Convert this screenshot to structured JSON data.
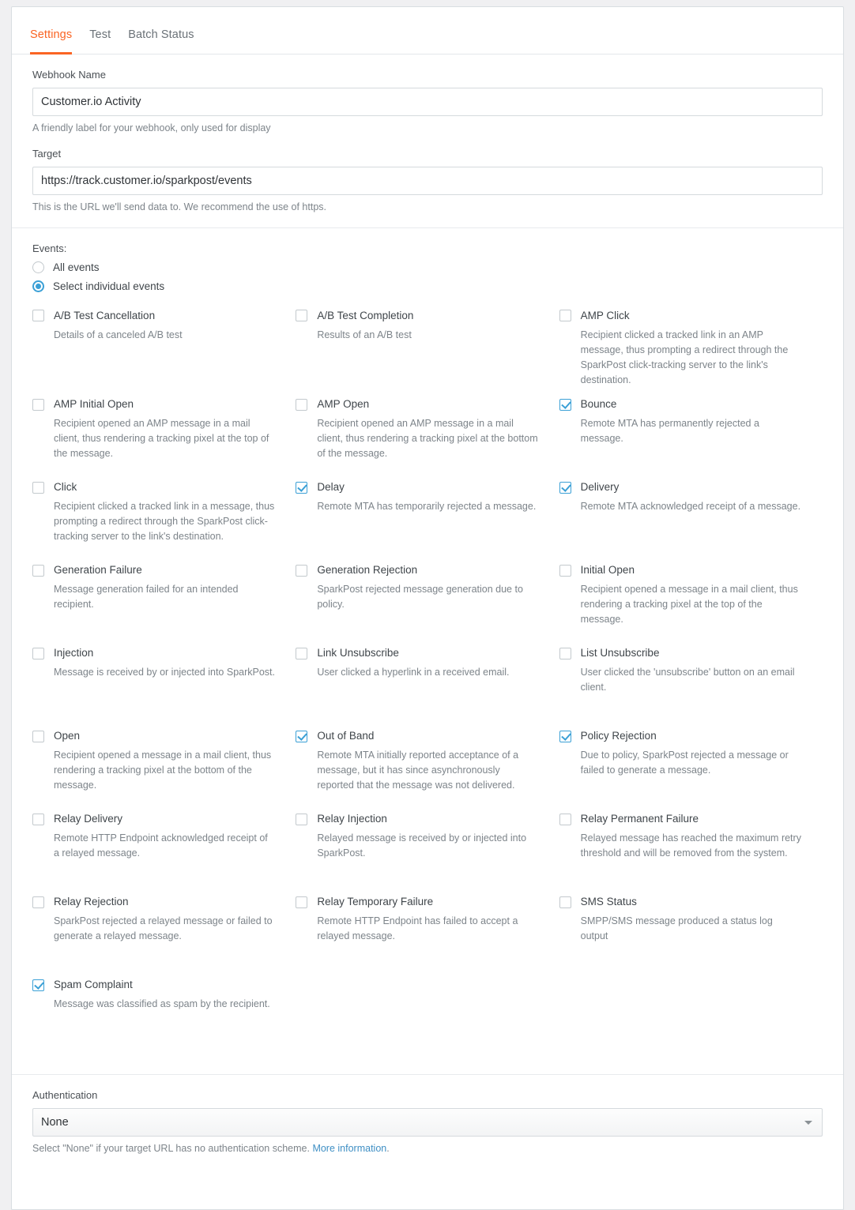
{
  "tabs": [
    {
      "label": "Settings",
      "active": true
    },
    {
      "label": "Test",
      "active": false
    },
    {
      "label": "Batch Status",
      "active": false
    }
  ],
  "colors": {
    "accent": "#fa6423",
    "checkbox_checked": "#3ba0d6",
    "link": "#3f8fc4"
  },
  "webhook_name": {
    "label": "Webhook Name",
    "value": "Customer.io Activity",
    "placeholder": "Webhook Name",
    "help": "A friendly label for your webhook, only used for display"
  },
  "target": {
    "label": "Target",
    "value": "https://track.customer.io/sparkpost/events",
    "placeholder": "https://",
    "help": "This is the URL we'll send data to. We recommend the use of https."
  },
  "events": {
    "label": "Events:",
    "radios": [
      {
        "label": "All events",
        "checked": false
      },
      {
        "label": "Select individual events",
        "checked": true
      }
    ],
    "items": [
      {
        "name": "A/B Test Cancellation",
        "desc": "Details of a canceled A/B test",
        "checked": false
      },
      {
        "name": "A/B Test Completion",
        "desc": "Results of an A/B test",
        "checked": false
      },
      {
        "name": "AMP Click",
        "desc": "Recipient clicked a tracked link in an AMP message, thus prompting a redirect through the SparkPost click-tracking server to the link's destination.",
        "checked": false
      },
      {
        "name": "AMP Initial Open",
        "desc": "Recipient opened an AMP message in a mail client, thus rendering a tracking pixel at the top of the message.",
        "checked": false
      },
      {
        "name": "AMP Open",
        "desc": "Recipient opened an AMP message in a mail client, thus rendering a tracking pixel at the bottom of the message.",
        "checked": false
      },
      {
        "name": "Bounce",
        "desc": "Remote MTA has permanently rejected a message.",
        "checked": true
      },
      {
        "name": "Click",
        "desc": "Recipient clicked a tracked link in a message, thus prompting a redirect through the SparkPost click-tracking server to the link's destination.",
        "checked": false
      },
      {
        "name": "Delay",
        "desc": "Remote MTA has temporarily rejected a message.",
        "checked": true
      },
      {
        "name": "Delivery",
        "desc": "Remote MTA acknowledged receipt of a message.",
        "checked": true
      },
      {
        "name": "Generation Failure",
        "desc": "Message generation failed for an intended recipient.",
        "checked": false
      },
      {
        "name": "Generation Rejection",
        "desc": "SparkPost rejected message generation due to policy.",
        "checked": false
      },
      {
        "name": "Initial Open",
        "desc": "Recipient opened a message in a mail client, thus rendering a tracking pixel at the top of the message.",
        "checked": false
      },
      {
        "name": "Injection",
        "desc": "Message is received by or injected into SparkPost.",
        "checked": false
      },
      {
        "name": "Link Unsubscribe",
        "desc": "User clicked a hyperlink in a received email.",
        "checked": false
      },
      {
        "name": "List Unsubscribe",
        "desc": "User clicked the 'unsubscribe' button on an email client.",
        "checked": false
      },
      {
        "name": "Open",
        "desc": "Recipient opened a message in a mail client, thus rendering a tracking pixel at the bottom of the message.",
        "checked": false
      },
      {
        "name": "Out of Band",
        "desc": "Remote MTA initially reported acceptance of a message, but it has since asynchronously reported that the message was not delivered.",
        "checked": true
      },
      {
        "name": "Policy Rejection",
        "desc": "Due to policy, SparkPost rejected a message or failed to generate a message.",
        "checked": true
      },
      {
        "name": "Relay Delivery",
        "desc": "Remote HTTP Endpoint acknowledged receipt of a relayed message.",
        "checked": false
      },
      {
        "name": "Relay Injection",
        "desc": "Relayed message is received by or injected into SparkPost.",
        "checked": false
      },
      {
        "name": "Relay Permanent Failure",
        "desc": "Relayed message has reached the maximum retry threshold and will be removed from the system.",
        "checked": false
      },
      {
        "name": "Relay Rejection",
        "desc": "SparkPost rejected a relayed message or failed to generate a relayed message.",
        "checked": false
      },
      {
        "name": "Relay Temporary Failure",
        "desc": "Remote HTTP Endpoint has failed to accept a relayed message.",
        "checked": false
      },
      {
        "name": "SMS Status",
        "desc": "SMPP/SMS message produced a status log output",
        "checked": false
      },
      {
        "name": "Spam Complaint",
        "desc": "Message was classified as spam by the recipient.",
        "checked": true
      }
    ]
  },
  "authentication": {
    "label": "Authentication",
    "selected": "None",
    "help_prefix": "Select \"None\" if your target URL has no authentication scheme. ",
    "help_link": "More information",
    "help_suffix": "."
  }
}
